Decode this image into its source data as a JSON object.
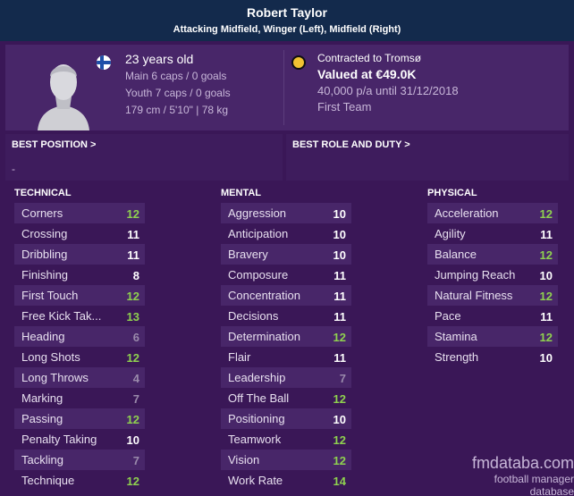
{
  "header": {
    "name": "Robert Taylor",
    "roles": "Attacking Midfield, Winger (Left), Midfield (Right)"
  },
  "profile": {
    "age": "23 years old",
    "main_caps": "Main 6 caps / 0 goals",
    "youth_caps": "Youth 7 caps / 0 goals",
    "physique": "179 cm / 5'10\" | 78 kg",
    "contract": "Contracted to Tromsø",
    "value": "Valued at €49.0K",
    "wage": "40,000 p/a until 31/12/2018",
    "squad": "First Team"
  },
  "positions": {
    "best_position_title": "BEST POSITION >",
    "best_position_value": "-",
    "best_role_title": "BEST ROLE AND DUTY >"
  },
  "colors": {
    "high": "#8fd14f",
    "mid": "#ffffff",
    "low": "#9a8aab"
  },
  "technical": {
    "title": "TECHNICAL",
    "items": [
      {
        "label": "Corners",
        "score": "12",
        "tier": "high"
      },
      {
        "label": "Crossing",
        "score": "11",
        "tier": "mid"
      },
      {
        "label": "Dribbling",
        "score": "11",
        "tier": "mid"
      },
      {
        "label": "Finishing",
        "score": "8",
        "tier": "mid"
      },
      {
        "label": "First Touch",
        "score": "12",
        "tier": "high"
      },
      {
        "label": "Free Kick Tak...",
        "score": "13",
        "tier": "high"
      },
      {
        "label": "Heading",
        "score": "6",
        "tier": "low"
      },
      {
        "label": "Long Shots",
        "score": "12",
        "tier": "high"
      },
      {
        "label": "Long Throws",
        "score": "4",
        "tier": "low"
      },
      {
        "label": "Marking",
        "score": "7",
        "tier": "low"
      },
      {
        "label": "Passing",
        "score": "12",
        "tier": "high"
      },
      {
        "label": "Penalty Taking",
        "score": "10",
        "tier": "mid"
      },
      {
        "label": "Tackling",
        "score": "7",
        "tier": "low"
      },
      {
        "label": "Technique",
        "score": "12",
        "tier": "high"
      }
    ]
  },
  "mental": {
    "title": "MENTAL",
    "items": [
      {
        "label": "Aggression",
        "score": "10",
        "tier": "mid"
      },
      {
        "label": "Anticipation",
        "score": "10",
        "tier": "mid"
      },
      {
        "label": "Bravery",
        "score": "10",
        "tier": "mid"
      },
      {
        "label": "Composure",
        "score": "11",
        "tier": "mid"
      },
      {
        "label": "Concentration",
        "score": "11",
        "tier": "mid"
      },
      {
        "label": "Decisions",
        "score": "11",
        "tier": "mid"
      },
      {
        "label": "Determination",
        "score": "12",
        "tier": "high"
      },
      {
        "label": "Flair",
        "score": "11",
        "tier": "mid"
      },
      {
        "label": "Leadership",
        "score": "7",
        "tier": "low"
      },
      {
        "label": "Off The Ball",
        "score": "12",
        "tier": "high"
      },
      {
        "label": "Positioning",
        "score": "10",
        "tier": "mid"
      },
      {
        "label": "Teamwork",
        "score": "12",
        "tier": "high"
      },
      {
        "label": "Vision",
        "score": "12",
        "tier": "high"
      },
      {
        "label": "Work Rate",
        "score": "14",
        "tier": "high"
      }
    ]
  },
  "physical": {
    "title": "PHYSICAL",
    "items": [
      {
        "label": "Acceleration",
        "score": "12",
        "tier": "high"
      },
      {
        "label": "Agility",
        "score": "11",
        "tier": "mid"
      },
      {
        "label": "Balance",
        "score": "12",
        "tier": "high"
      },
      {
        "label": "Jumping Reach",
        "score": "10",
        "tier": "mid"
      },
      {
        "label": "Natural Fitness",
        "score": "12",
        "tier": "high"
      },
      {
        "label": "Pace",
        "score": "11",
        "tier": "mid"
      },
      {
        "label": "Stamina",
        "score": "12",
        "tier": "high"
      },
      {
        "label": "Strength",
        "score": "10",
        "tier": "mid"
      }
    ]
  },
  "watermark": {
    "site": "fmdataba.com",
    "tagline": "football manager database"
  }
}
